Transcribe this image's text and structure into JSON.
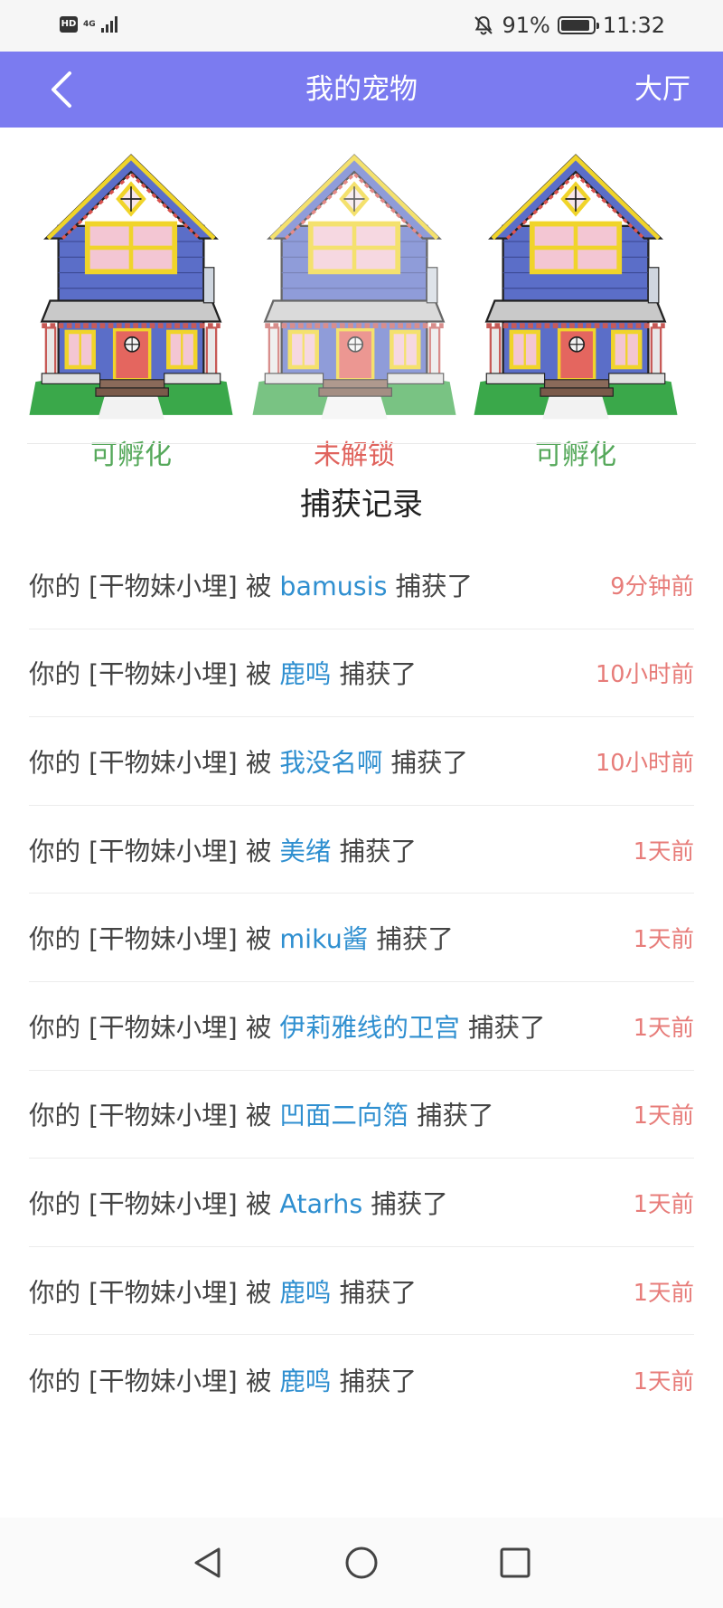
{
  "status_bar": {
    "hd": "HD",
    "network": "4G",
    "battery_text": "91%",
    "battery_level": 0.91,
    "time": "11:32",
    "icons": [
      "hd-icon",
      "signal-icon",
      "mute-bell-icon",
      "battery-icon"
    ]
  },
  "header": {
    "back_icon": "chevron-left-icon",
    "title": "我的宠物",
    "hall": "大厅",
    "color": "#7b7bf0"
  },
  "pets": [
    {
      "status": "可孵化",
      "state": "hatchable"
    },
    {
      "status": "未解锁",
      "state": "locked"
    },
    {
      "status": "可孵化",
      "state": "hatchable"
    }
  ],
  "records": {
    "title": "捕获记录",
    "items": [
      {
        "prefix": "你的 [干物妹小埋] 被 ",
        "catcher": "bamusis",
        "suffix": " 捕获了",
        "time": "9分钟前"
      },
      {
        "prefix": "你的 [干物妹小埋] 被 ",
        "catcher": "鹿鸣",
        "suffix": " 捕获了",
        "time": "10小时前"
      },
      {
        "prefix": "你的 [干物妹小埋] 被 ",
        "catcher": "我没名啊",
        "suffix": " 捕获了",
        "time": "10小时前"
      },
      {
        "prefix": "你的 [干物妹小埋] 被 ",
        "catcher": "美绪",
        "suffix": " 捕获了",
        "time": "1天前"
      },
      {
        "prefix": "你的 [干物妹小埋] 被 ",
        "catcher": "miku酱",
        "suffix": " 捕获了",
        "time": "1天前"
      },
      {
        "prefix": "你的 [干物妹小埋] 被 ",
        "catcher": "伊莉雅线的卫宫",
        "suffix": " 捕获了",
        "time": "1天前"
      },
      {
        "prefix": "你的 [干物妹小埋] 被 ",
        "catcher": "凹面二向箔",
        "suffix": " 捕获了",
        "time": "1天前"
      },
      {
        "prefix": "你的 [干物妹小埋] 被 ",
        "catcher": "Atarhs",
        "suffix": " 捕获了",
        "time": "1天前"
      },
      {
        "prefix": "你的 [干物妹小埋] 被 ",
        "catcher": "鹿鸣",
        "suffix": " 捕获了",
        "time": "1天前"
      },
      {
        "prefix": "你的 [干物妹小埋] 被 ",
        "catcher": "鹿鸣",
        "suffix": " 捕获了",
        "time": "1天前"
      }
    ]
  },
  "nav_bar": {
    "icons": [
      "nav-back-icon",
      "nav-home-icon",
      "nav-recents-icon"
    ]
  },
  "colors": {
    "catcher_name": "#2f8fd0",
    "time": "#e77c79",
    "hatchable": "#55a85a",
    "locked": "#e0635d"
  }
}
